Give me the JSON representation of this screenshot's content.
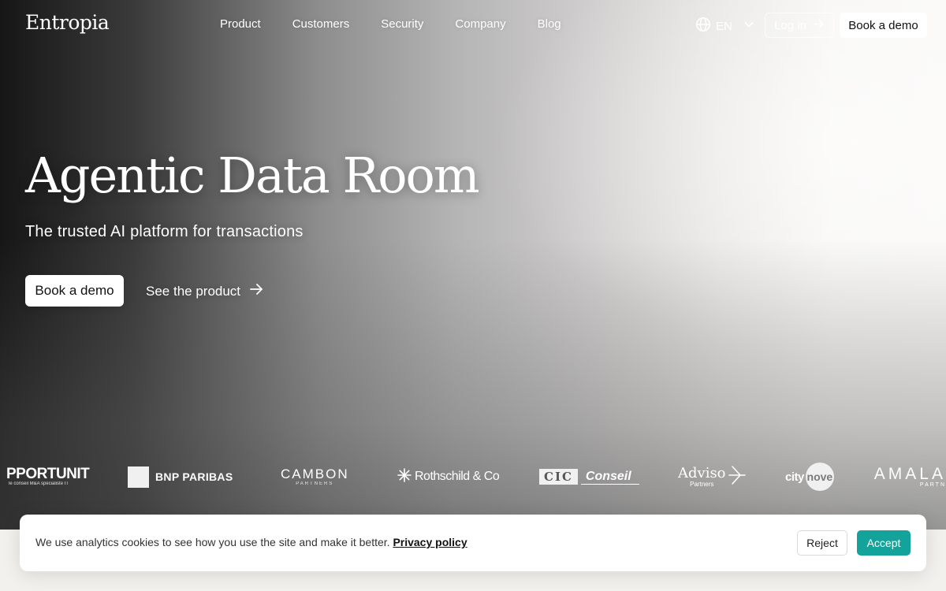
{
  "nav": {
    "logo": "Entropia",
    "links": [
      {
        "label": "Product"
      },
      {
        "label": "Customers"
      },
      {
        "label": "Security"
      },
      {
        "label": "Company"
      },
      {
        "label": "Blog"
      }
    ],
    "language": "EN",
    "login_label": "Log in",
    "demo_label": "Book a demo"
  },
  "hero": {
    "title": "Agentic Data Room",
    "subtitle": "The trusted AI platform for transactions",
    "primary_cta": "Book a demo",
    "secondary_cta": "See the product"
  },
  "clients": {
    "opportunit": {
      "name": "PPORTUNIT",
      "tagline": "le conseil M&A spécialiste IT"
    },
    "bnp": {
      "name": "BNP PARIBAS"
    },
    "cambon": {
      "name": "CAMBON",
      "tagline": "PARTNERS"
    },
    "rothschild": {
      "name": "Rothschild & Co"
    },
    "cic": {
      "name": "CIC",
      "suffix": "Conseil"
    },
    "adviso": {
      "name": "Adviso",
      "tagline": "Partners"
    },
    "citynove": {
      "name": "city",
      "suffix": "nove"
    },
    "amala": {
      "name": "AMALA",
      "tagline": "PARTN"
    }
  },
  "cookie": {
    "message": "We use analytics cookies to see how you use the site and make it better.",
    "policy_link": "Privacy policy",
    "reject_label": "Reject",
    "accept_label": "Accept"
  },
  "colors": {
    "accent": "#14a39a",
    "page_background": "#f3f1ed"
  }
}
